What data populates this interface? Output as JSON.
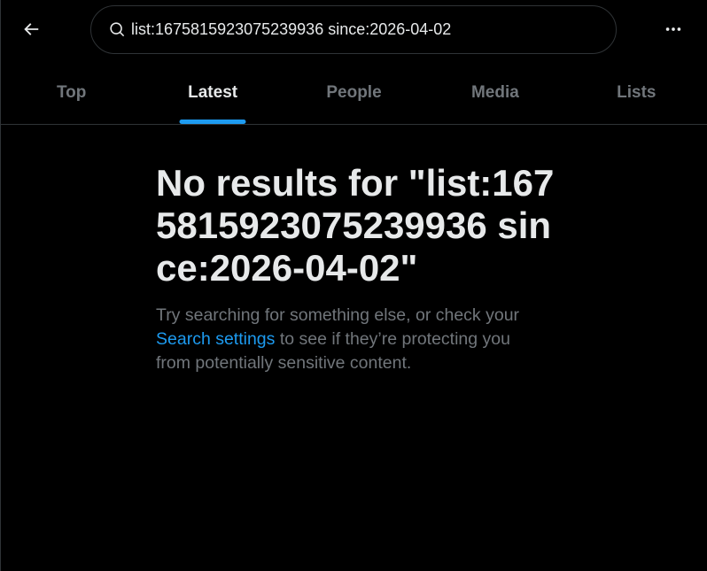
{
  "search": {
    "query": "list:1675815923075239936 since:2026-04-02"
  },
  "tabs": [
    {
      "label": "Top",
      "active": false
    },
    {
      "label": "Latest",
      "active": true
    },
    {
      "label": "People",
      "active": false
    },
    {
      "label": "Media",
      "active": false
    },
    {
      "label": "Lists",
      "active": false
    }
  ],
  "empty_state": {
    "title": "No results for \"list:1675815923075239936 since:2026-04-02\"",
    "desc_before": "Try searching for something else, or check your ",
    "desc_link": "Search settings",
    "desc_after": " to see if they’re protecting you from potentially sensitive content."
  },
  "icons": {
    "back": "arrow-left-icon",
    "search": "search-icon",
    "more": "more-horizontal-icon"
  },
  "colors": {
    "background": "#000000",
    "text_primary": "#e7e9ea",
    "text_secondary": "#71767b",
    "accent": "#1d9bf0",
    "border": "#2f3336"
  }
}
